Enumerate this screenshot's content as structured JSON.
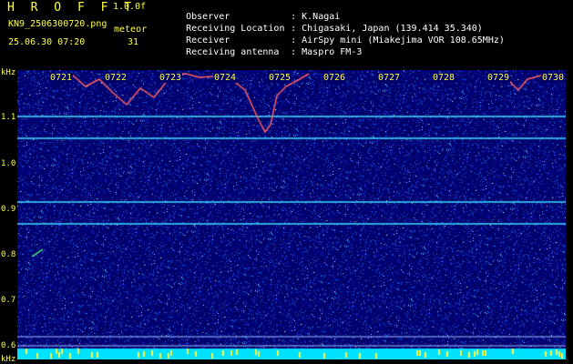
{
  "header": {
    "app_title": "H R O F F T",
    "version": "1.0.0f",
    "filename": "KN9_2506300720.png",
    "mode": "meteor",
    "datetime": "25.06.30 07:20",
    "count": "31"
  },
  "info": {
    "observer_label": "Observer",
    "observer_value": ": K.Nagai",
    "location_label": "Receiving Location",
    "location_value": ": Chigasaki, Japan (139.414 35.340)",
    "receiver_label": "Receiver",
    "receiver_value": ": AirSpy mini (Miakejima VOR 108.65MHz)",
    "antenna_label": "Receiving antenna",
    "antenna_value": ": Maspro FM-3"
  },
  "axis": {
    "unit": "kHz",
    "y_labels": [
      "1.1",
      "1.0",
      "0.9",
      "0.8",
      "0.7",
      "0.6"
    ],
    "bottom_unit": "kHz"
  },
  "time_labels": [
    "0721",
    "0722",
    "0723",
    "0724",
    "0725",
    "0726",
    "0727",
    "0728",
    "0729",
    "0730"
  ],
  "colors": {
    "accent_yellow": "#ffff40",
    "background_blue": "#000066",
    "trace_line": "#40e0ff",
    "meteor_trace": "#ff6060",
    "bottom_band": "#00e0ff"
  }
}
